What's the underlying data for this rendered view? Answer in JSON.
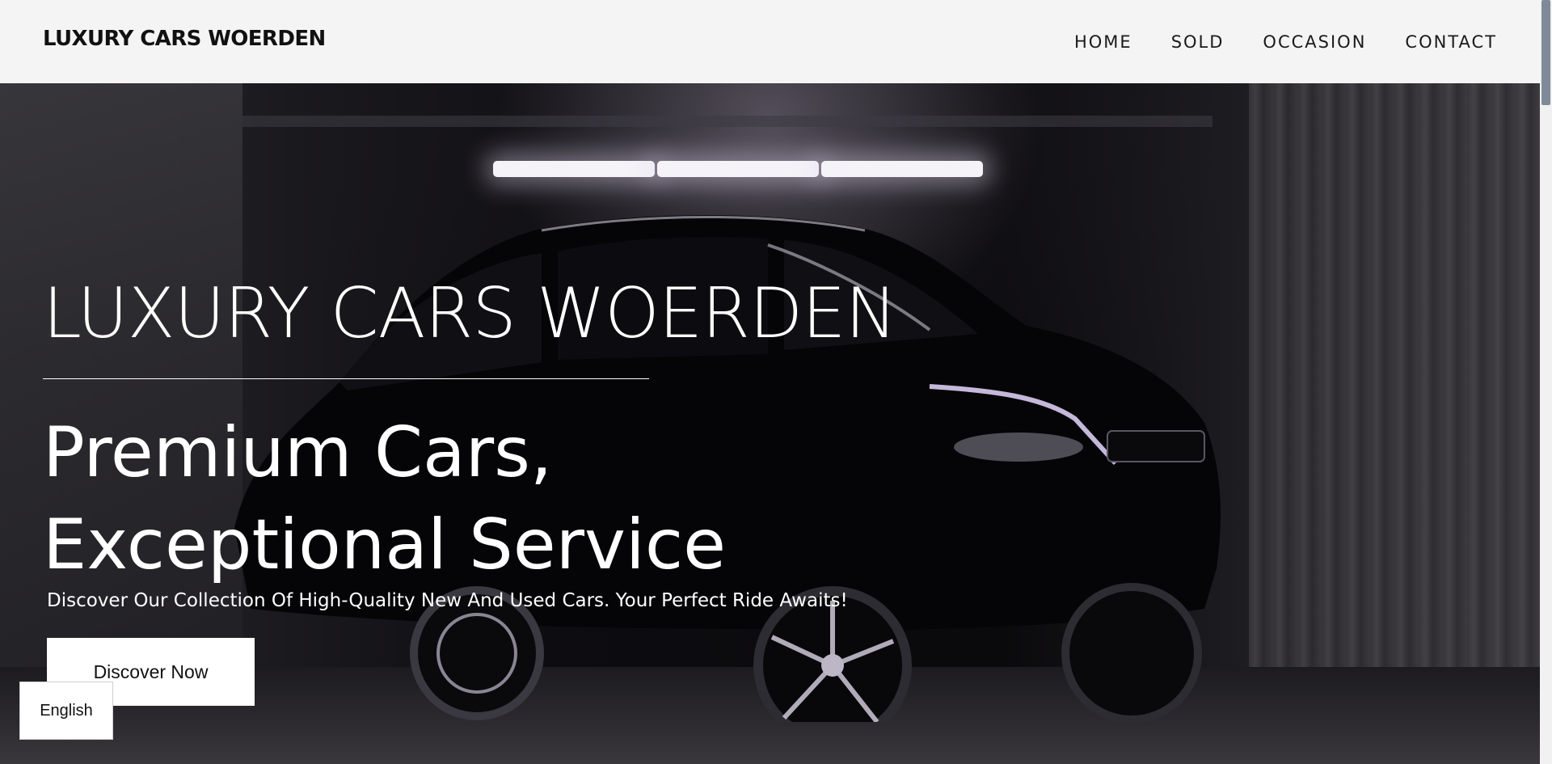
{
  "header": {
    "brand": "LUXURY CARS WOERDEN",
    "nav": [
      {
        "label": "HOME"
      },
      {
        "label": "SOLD"
      },
      {
        "label": "OCCASION"
      },
      {
        "label": "CONTACT"
      }
    ]
  },
  "hero": {
    "title": "LUXURY CARS WOERDEN",
    "tagline_line1": "Premium Cars,",
    "tagline_line2": "Exceptional Service",
    "subtitle": "Discover Our Collection Of High-Quality New And Used Cars. Your Perfect Ride Awaits!",
    "cta_label": "Discover Now"
  },
  "language": {
    "label": "English"
  },
  "colors": {
    "header_bg": "#f4f4f4",
    "hero_text": "#ffffff",
    "scroll_thumb": "#7e8a98"
  }
}
